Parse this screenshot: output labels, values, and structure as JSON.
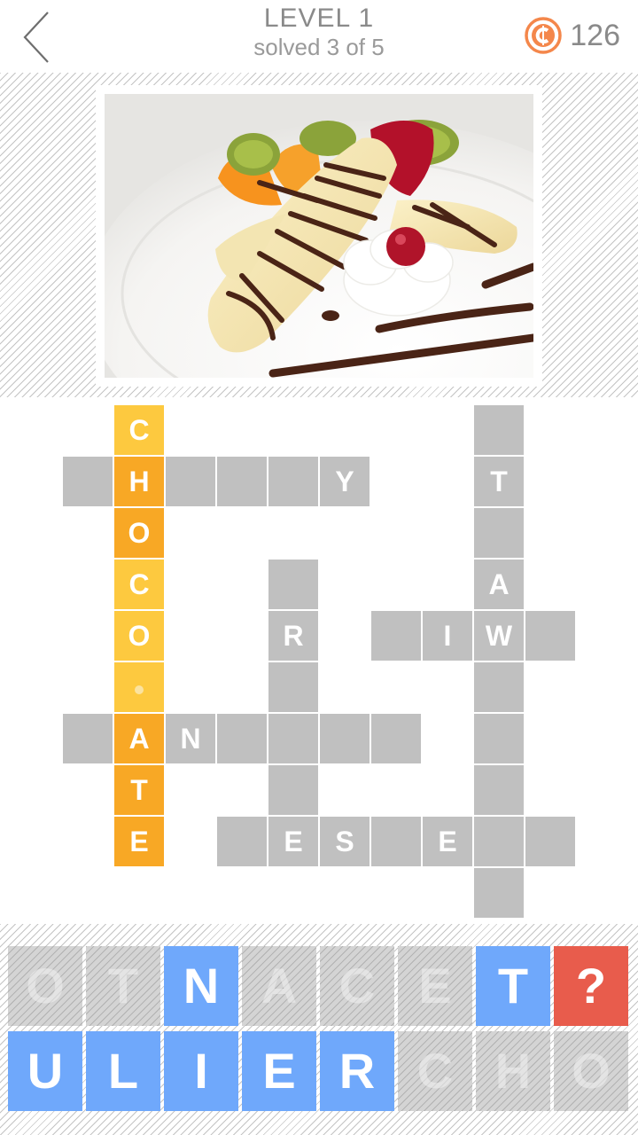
{
  "header": {
    "back_icon": "chevron-left-icon",
    "title": "LEVEL 1",
    "subtitle": "solved 3 of 5",
    "coin_icon": "coin-icon",
    "coin_count": "126"
  },
  "picture": {
    "description": "Banana split dessert with chocolate sauce, whipped cream, cherry, kiwi, orange and strawberry on a white plate"
  },
  "colors": {
    "cell_empty": "#c0c0c0",
    "cell_highlight_light": "#fdc93f",
    "cell_highlight_dark": "#f8a825",
    "tile_active": "#6fa8fb",
    "tile_hint": "#e85c4c",
    "coin": "#f4874b"
  },
  "crossword": {
    "cells": [
      {
        "row": 0,
        "col": 1,
        "letter": "C",
        "style": "yellow"
      },
      {
        "row": 1,
        "col": 1,
        "letter": "H",
        "style": "orange"
      },
      {
        "row": 2,
        "col": 1,
        "letter": "O",
        "style": "orange"
      },
      {
        "row": 3,
        "col": 1,
        "letter": "C",
        "style": "yellow"
      },
      {
        "row": 4,
        "col": 1,
        "letter": "O",
        "style": "yellow"
      },
      {
        "row": 5,
        "col": 1,
        "letter": "",
        "style": "yellow",
        "cursor": true
      },
      {
        "row": 6,
        "col": 1,
        "letter": "A",
        "style": "orange"
      },
      {
        "row": 7,
        "col": 1,
        "letter": "T",
        "style": "orange"
      },
      {
        "row": 8,
        "col": 1,
        "letter": "E",
        "style": "orange"
      },
      {
        "row": 1,
        "col": 0,
        "letter": "",
        "style": "gray"
      },
      {
        "row": 1,
        "col": 2,
        "letter": "",
        "style": "gray"
      },
      {
        "row": 1,
        "col": 3,
        "letter": "",
        "style": "gray"
      },
      {
        "row": 1,
        "col": 4,
        "letter": "",
        "style": "gray"
      },
      {
        "row": 1,
        "col": 5,
        "letter": "Y",
        "style": "gray"
      },
      {
        "row": 0,
        "col": 8,
        "letter": "",
        "style": "gray"
      },
      {
        "row": 1,
        "col": 8,
        "letter": "T",
        "style": "gray"
      },
      {
        "row": 2,
        "col": 8,
        "letter": "",
        "style": "gray"
      },
      {
        "row": 3,
        "col": 8,
        "letter": "A",
        "style": "gray"
      },
      {
        "row": 4,
        "col": 8,
        "letter": "W",
        "style": "gray"
      },
      {
        "row": 5,
        "col": 8,
        "letter": "",
        "style": "gray"
      },
      {
        "row": 6,
        "col": 8,
        "letter": "",
        "style": "gray"
      },
      {
        "row": 7,
        "col": 8,
        "letter": "",
        "style": "gray"
      },
      {
        "row": 8,
        "col": 8,
        "letter": "",
        "style": "gray"
      },
      {
        "row": 9,
        "col": 8,
        "letter": "",
        "style": "gray"
      },
      {
        "row": 3,
        "col": 4,
        "letter": "",
        "style": "gray"
      },
      {
        "row": 4,
        "col": 4,
        "letter": "R",
        "style": "gray"
      },
      {
        "row": 5,
        "col": 4,
        "letter": "",
        "style": "gray"
      },
      {
        "row": 6,
        "col": 4,
        "letter": "",
        "style": "gray"
      },
      {
        "row": 7,
        "col": 4,
        "letter": "",
        "style": "gray"
      },
      {
        "row": 8,
        "col": 4,
        "letter": "E",
        "style": "gray"
      },
      {
        "row": 4,
        "col": 6,
        "letter": "",
        "style": "gray"
      },
      {
        "row": 4,
        "col": 7,
        "letter": "I",
        "style": "gray"
      },
      {
        "row": 4,
        "col": 9,
        "letter": "",
        "style": "gray"
      },
      {
        "row": 6,
        "col": 0,
        "letter": "",
        "style": "gray"
      },
      {
        "row": 6,
        "col": 2,
        "letter": "N",
        "style": "gray"
      },
      {
        "row": 6,
        "col": 3,
        "letter": "",
        "style": "gray"
      },
      {
        "row": 6,
        "col": 5,
        "letter": "",
        "style": "gray"
      },
      {
        "row": 6,
        "col": 6,
        "letter": "",
        "style": "gray"
      },
      {
        "row": 8,
        "col": 3,
        "letter": "",
        "style": "gray"
      },
      {
        "row": 8,
        "col": 5,
        "letter": "S",
        "style": "gray"
      },
      {
        "row": 8,
        "col": 6,
        "letter": "",
        "style": "gray"
      },
      {
        "row": 8,
        "col": 7,
        "letter": "E",
        "style": "gray"
      },
      {
        "row": 8,
        "col": 9,
        "letter": "",
        "style": "gray"
      }
    ]
  },
  "letter_bank": {
    "rows": [
      [
        {
          "letter": "O",
          "state": "used"
        },
        {
          "letter": "T",
          "state": "used"
        },
        {
          "letter": "N",
          "state": "active"
        },
        {
          "letter": "A",
          "state": "used"
        },
        {
          "letter": "C",
          "state": "used"
        },
        {
          "letter": "E",
          "state": "used"
        },
        {
          "letter": "T",
          "state": "active"
        },
        {
          "letter": "?",
          "state": "hint"
        }
      ],
      [
        {
          "letter": "U",
          "state": "active"
        },
        {
          "letter": "L",
          "state": "active"
        },
        {
          "letter": "I",
          "state": "active"
        },
        {
          "letter": "E",
          "state": "active"
        },
        {
          "letter": "R",
          "state": "active"
        },
        {
          "letter": "C",
          "state": "used"
        },
        {
          "letter": "H",
          "state": "used"
        },
        {
          "letter": "O",
          "state": "used"
        }
      ]
    ]
  }
}
